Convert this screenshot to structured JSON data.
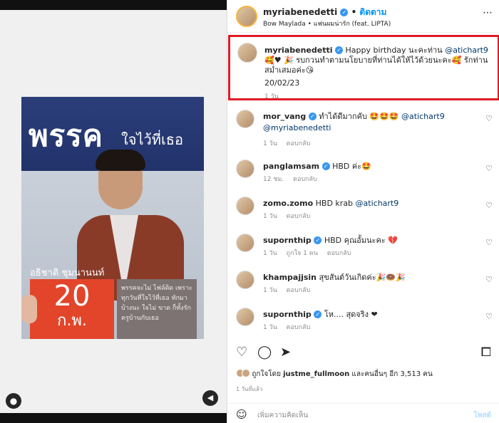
{
  "post": {
    "username": "myriabenedetti",
    "follow_label": "ติดตาม",
    "subtitle": "Bow Maylada • แฟนผมน่ารัก (feat. LIPTA)",
    "more": "⋯"
  },
  "poster": {
    "party": "พรรค",
    "slogan": "ใจไว้ที่เธอ",
    "name": "อธิชาติ ชุมนานนท์",
    "date_day": "20",
    "date_month": "ก.พ.",
    "quote": "พรรคจะไม่ ไฟล์ติด เพราะทุกวันที่ใจไว้ที่เธอ ทักมาบ้างนะ ใจไม่ ขาด ก็ทั้งรัก ครูบ้านกับเธอ"
  },
  "caption": {
    "username": "myriabenedetti",
    "text_pre": "Happy birthday นะคะท่าน ",
    "mention": "@atichart9",
    "text_post": " 🥰♥ 🎉 รบกวนทำตามนโยบายที่ท่านได้ให้ไว้ด้วยนะคะ🥰 รักท่านสม่ำเสมอค่ะ😘",
    "date": "20/02/23",
    "time": "1 วัน"
  },
  "comments": [
    {
      "user": "mor_vang",
      "verified": true,
      "text": "ทำได้ดีมากคับ 🤩🤩🤩 ",
      "mention": "@atichart9",
      "mention2": "@myriabenedetti",
      "time": "1 วัน",
      "likes": "",
      "reply": "ตอบกลับ"
    },
    {
      "user": "panglamsam",
      "verified": true,
      "text": "HBD ค่ะ🤩",
      "mention": "",
      "time": "12 ชม.",
      "likes": "",
      "reply": "ตอบกลับ"
    },
    {
      "user": "zomo.zomo",
      "verified": false,
      "text": "HBD krab ",
      "mention": "@atichart9",
      "time": "1 วัน",
      "likes": "",
      "reply": "ตอบกลับ"
    },
    {
      "user": "supornthip",
      "verified": true,
      "text": "HBD คุณอั้มนะคะ 💔",
      "mention": "",
      "time": "1 วัน",
      "likes": "ถูกใจ 1 คน",
      "reply": "ตอบกลับ"
    },
    {
      "user": "khampajjsin",
      "verified": false,
      "text": "สุขสันต์วันเกิดค่ะ🎉🍩🎉",
      "mention": "",
      "time": "1 วัน",
      "likes": "",
      "reply": "ตอบกลับ"
    },
    {
      "user": "supornthip",
      "verified": true,
      "text": "โห.... สุดจริง ❤",
      "mention": "",
      "time": "1 วัน",
      "likes": "",
      "reply": "ตอบกลับ"
    }
  ],
  "likes_text_pre": "ถูกใจโดย ",
  "likes_user": "justme_fullmoon",
  "likes_text_post": " และคนอื่นๆ อีก 3,513 คน",
  "ago": "1 วันที่แล้ว",
  "add_comment": {
    "placeholder": "เพิ่มความคิดเห็น",
    "post_label": "โพสต์"
  },
  "icons": {
    "like": "♡",
    "comment": "◯",
    "share": "➤",
    "save": "⧠",
    "emoji": "☺",
    "user": "●",
    "sound": "◀"
  }
}
